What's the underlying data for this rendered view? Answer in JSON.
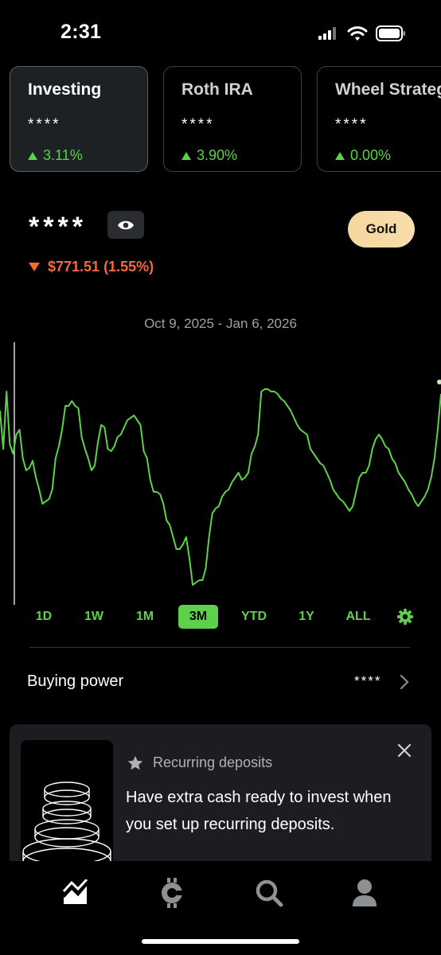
{
  "status_bar": {
    "time": "2:31"
  },
  "accounts": [
    {
      "name": "Investing",
      "value": "****",
      "change": "3.11%",
      "active": true
    },
    {
      "name": "Roth IRA",
      "value": "****",
      "change": "3.90%",
      "active": false
    },
    {
      "name": "Wheel Strategy",
      "value": "****",
      "change": "0.00%",
      "active": false
    }
  ],
  "portfolio": {
    "balance": "****",
    "change": "$771.51 (1.55%)",
    "gold_label": "Gold",
    "date_range": "Oct 9, 2025 - Jan 6, 2026"
  },
  "chart_data": {
    "type": "line",
    "series_color": "#5ed14a",
    "y_relative": [
      0.78,
      0.62,
      0.86,
      0.64,
      0.6,
      0.68,
      0.7,
      0.58,
      0.53,
      0.54,
      0.57,
      0.5,
      0.45,
      0.39,
      0.4,
      0.41,
      0.45,
      0.58,
      0.63,
      0.7,
      0.8,
      0.8,
      0.82,
      0.8,
      0.79,
      0.67,
      0.62,
      0.58,
      0.53,
      0.55,
      0.65,
      0.72,
      0.71,
      0.62,
      0.61,
      0.63,
      0.67,
      0.68,
      0.71,
      0.74,
      0.75,
      0.76,
      0.74,
      0.72,
      0.61,
      0.58,
      0.49,
      0.44,
      0.44,
      0.43,
      0.39,
      0.32,
      0.3,
      0.25,
      0.2,
      0.2,
      0.22,
      0.25,
      0.16,
      0.05,
      0.06,
      0.07,
      0.07,
      0.12,
      0.25,
      0.35,
      0.37,
      0.38,
      0.42,
      0.44,
      0.45,
      0.48,
      0.5,
      0.52,
      0.49,
      0.5,
      0.52,
      0.6,
      0.63,
      0.68,
      0.86,
      0.87,
      0.87,
      0.86,
      0.86,
      0.85,
      0.83,
      0.82,
      0.8,
      0.78,
      0.75,
      0.72,
      0.7,
      0.69,
      0.68,
      0.62,
      0.6,
      0.58,
      0.56,
      0.55,
      0.52,
      0.49,
      0.45,
      0.43,
      0.41,
      0.4,
      0.38,
      0.36,
      0.38,
      0.44,
      0.5,
      0.52,
      0.52,
      0.55,
      0.62,
      0.66,
      0.68,
      0.66,
      0.63,
      0.62,
      0.58,
      0.56,
      0.52,
      0.5,
      0.48,
      0.45,
      0.43,
      0.4,
      0.38,
      0.4,
      0.42,
      0.45,
      0.5,
      0.58,
      0.7,
      0.85
    ]
  },
  "range_tabs": [
    "1D",
    "1W",
    "1M",
    "3M",
    "YTD",
    "1Y",
    "ALL"
  ],
  "range_selected": "3M",
  "buying_power": {
    "label": "Buying power",
    "value": "****"
  },
  "promo": {
    "title": "Recurring deposits",
    "body": "Have extra cash ready to invest when you set up recurring deposits."
  },
  "nav": [
    "chart-icon",
    "crypto-icon",
    "search-icon",
    "profile-icon"
  ],
  "colors": {
    "positive": "#5ed14a",
    "negative": "#f36a3b",
    "gold": "#f7dba5",
    "card_bg": "#1e2124"
  }
}
